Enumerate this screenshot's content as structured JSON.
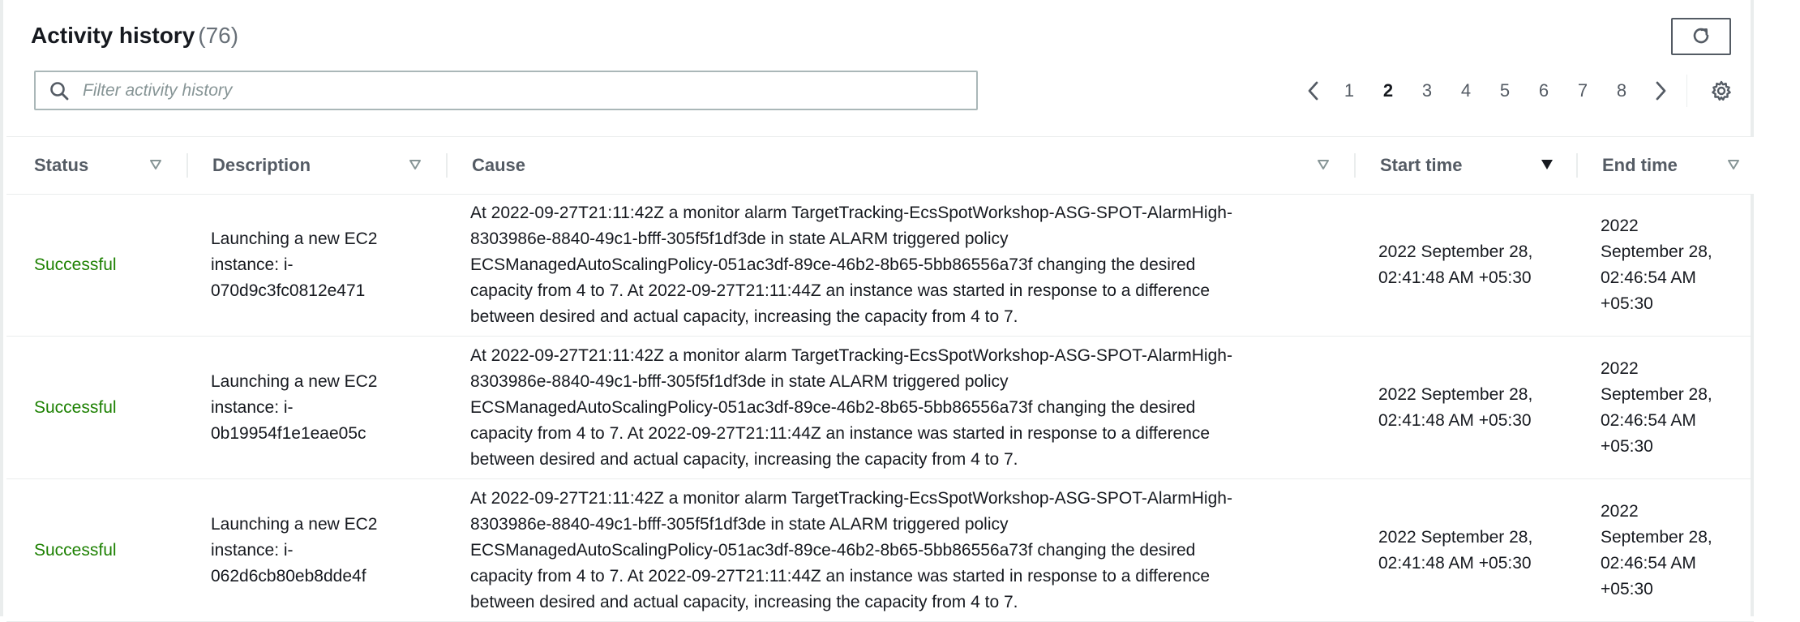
{
  "header": {
    "title": "Activity history",
    "count": "(76)"
  },
  "search": {
    "placeholder": "Filter activity history",
    "value": ""
  },
  "pagination": {
    "pages": [
      "1",
      "2",
      "3",
      "4",
      "5",
      "6",
      "7",
      "8"
    ],
    "current": "2",
    "prev_icon": "chevron-left-icon",
    "next_icon": "chevron-right-icon"
  },
  "toolbar": {
    "refresh_icon": "refresh-icon",
    "settings_icon": "gear-icon"
  },
  "table": {
    "columns": {
      "status": "Status",
      "description": "Description",
      "cause": "Cause",
      "start_time": "Start time",
      "end_time": "End time"
    },
    "sorted_column": "start_time",
    "rows": [
      {
        "status": "Successful",
        "description_lines": [
          "Launching a new EC2",
          "instance: i-",
          "070d9c3fc0812e471"
        ],
        "cause_lines": [
          "At 2022-09-27T21:11:42Z a monitor alarm TargetTracking-EcsSpotWorkshop-ASG-SPOT-AlarmHigh-",
          "8303986e-8840-49c1-bfff-305f5f1df3de in state ALARM triggered policy",
          "ECSManagedAutoScalingPolicy-051ac3df-89ce-46b2-8b65-5bb86556a73f changing the desired",
          "capacity from 4 to 7. At 2022-09-27T21:11:44Z an instance was started in response to a difference",
          "between desired and actual capacity, increasing the capacity from 4 to 7."
        ],
        "start_lines": [
          "2022 September 28,",
          "02:41:48 AM +05:30"
        ],
        "end_lines": [
          "2022",
          "September 28,",
          "02:46:54 AM",
          "+05:30"
        ]
      },
      {
        "status": "Successful",
        "description_lines": [
          "Launching a new EC2",
          "instance: i-",
          "0b19954f1e1eae05c"
        ],
        "cause_lines": [
          "At 2022-09-27T21:11:42Z a monitor alarm TargetTracking-EcsSpotWorkshop-ASG-SPOT-AlarmHigh-",
          "8303986e-8840-49c1-bfff-305f5f1df3de in state ALARM triggered policy",
          "ECSManagedAutoScalingPolicy-051ac3df-89ce-46b2-8b65-5bb86556a73f changing the desired",
          "capacity from 4 to 7. At 2022-09-27T21:11:44Z an instance was started in response to a difference",
          "between desired and actual capacity, increasing the capacity from 4 to 7."
        ],
        "start_lines": [
          "2022 September 28,",
          "02:41:48 AM +05:30"
        ],
        "end_lines": [
          "2022",
          "September 28,",
          "02:46:54 AM",
          "+05:30"
        ]
      },
      {
        "status": "Successful",
        "description_lines": [
          "Launching a new EC2",
          "instance: i-",
          "062d6cb80eb8dde4f"
        ],
        "cause_lines": [
          "At 2022-09-27T21:11:42Z a monitor alarm TargetTracking-EcsSpotWorkshop-ASG-SPOT-AlarmHigh-",
          "8303986e-8840-49c1-bfff-305f5f1df3de in state ALARM triggered policy",
          "ECSManagedAutoScalingPolicy-051ac3df-89ce-46b2-8b65-5bb86556a73f changing the desired",
          "capacity from 4 to 7. At 2022-09-27T21:11:44Z an instance was started in response to a difference",
          "between desired and actual capacity, increasing the capacity from 4 to 7."
        ],
        "start_lines": [
          "2022 September 28,",
          "02:41:48 AM +05:30"
        ],
        "end_lines": [
          "2022",
          "September 28,",
          "02:46:54 AM",
          "+05:30"
        ]
      }
    ]
  },
  "colors": {
    "success": "#1d8102",
    "header_text": "#545b64",
    "body_text": "#16191f"
  }
}
